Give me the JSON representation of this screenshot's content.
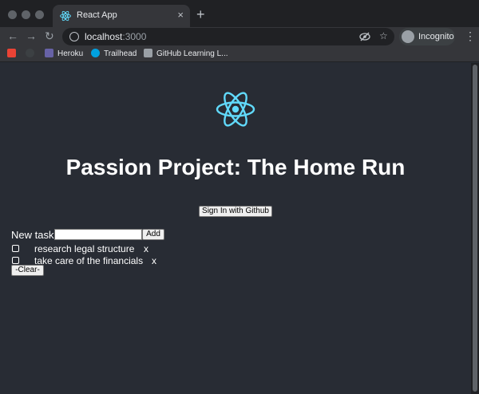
{
  "browser": {
    "tab_title": "React App",
    "tab_close": "×",
    "new_tab": "+",
    "url_host": "localhost",
    "url_port": ":3000",
    "profile_label": "Incognito",
    "nav": {
      "back": "←",
      "forward": "→",
      "reload": "↻"
    },
    "menu": "⋮",
    "bookmarks": [
      {
        "label": "",
        "icon": "gmail-icon",
        "color": "#ea4335"
      },
      {
        "label": "",
        "icon": "github-icon",
        "color": "#3c4043"
      },
      {
        "label": "Heroku",
        "icon": "heroku-icon",
        "color": "#6762a6"
      },
      {
        "label": "Trailhead",
        "icon": "trailhead-icon",
        "color": "#00a1e0"
      },
      {
        "label": "GitHub Learning L...",
        "icon": "github-learning-icon",
        "color": "#9aa0a6"
      }
    ]
  },
  "app": {
    "heading": "Passion Project: The Home Run",
    "signin_label": "Sign In with Github",
    "new_task_label": "New task:",
    "input_value": "",
    "add_label": "Add",
    "tasks": [
      {
        "text": "research legal structure",
        "delete": "x",
        "checked": false
      },
      {
        "text": "take care of the financials",
        "delete": "x",
        "checked": false
      }
    ],
    "clear_label": "-Clear-",
    "colors": {
      "react_blue": "#61dafb",
      "background": "#282c34"
    }
  }
}
